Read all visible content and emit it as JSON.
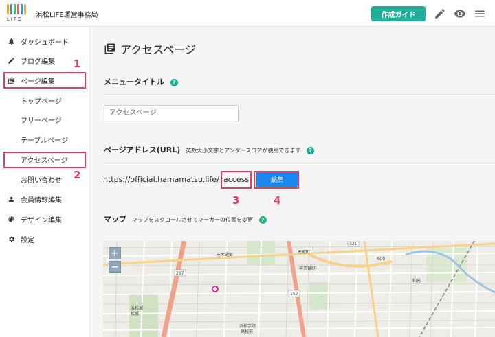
{
  "header": {
    "logo_text": "LIFE",
    "site_name": "浜松LIFE運営事務局",
    "guide_button": "作成ガイド",
    "icons": [
      "pencil-icon",
      "eye-icon",
      "menu-icon"
    ]
  },
  "sidebar": {
    "items": [
      {
        "label": "ダッシュボード",
        "icon": "bell-icon"
      },
      {
        "label": "ブログ編集",
        "icon": "pencil-icon"
      },
      {
        "label": "ページ編集",
        "icon": "pages-icon"
      },
      {
        "label": "トップページ"
      },
      {
        "label": "フリーページ"
      },
      {
        "label": "テーブルページ"
      },
      {
        "label": "アクセスページ"
      },
      {
        "label": "お問い合わせ"
      },
      {
        "label": "会員情報編集",
        "icon": "person-icon"
      },
      {
        "label": "デザイン編集",
        "icon": "palette-icon"
      },
      {
        "label": "設定",
        "icon": "gear-icon"
      }
    ]
  },
  "main": {
    "page_title": "アクセスページ",
    "menu_title_label": "メニュータイトル",
    "menu_title_value": "アクセスページ",
    "url_label": "ページアドレス(URL)",
    "url_note": "英数大小文字とアンダースコアが使用できます",
    "url_prefix": "https://official.hamamatsu.life/",
    "url_slug": "access",
    "edit_button": "編集",
    "map_label": "マップ",
    "map_note": "マップをスクロールさせてマーカーの位置を変更",
    "help_mark": "?",
    "zoom_in": "+",
    "zoom_out": "−",
    "map_labels": [
      "市木通郎",
      "中央番町",
      "257",
      "152",
      "321",
      "浜松学院",
      "高校前",
      "元城町",
      "和光",
      "浜松城",
      "松城",
      "昭和"
    ]
  },
  "callouts": [
    "1",
    "2",
    "3",
    "4"
  ],
  "colors": {
    "accent": "#1fae97",
    "primary_button": "#1a86f0",
    "highlight": "#e43c5c"
  }
}
